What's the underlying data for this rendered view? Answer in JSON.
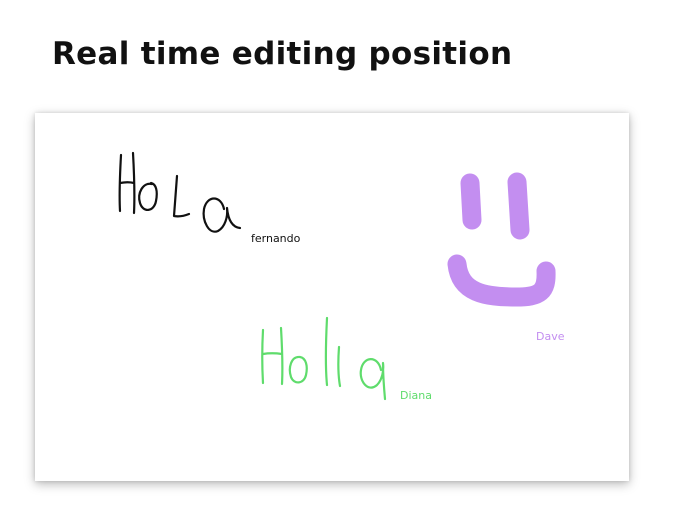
{
  "page": {
    "title": "Real time editing position"
  },
  "canvas": {
    "strokes": [
      {
        "author": "fernando",
        "text": "Hola",
        "color": "#111111",
        "shape": "handwritten-text"
      },
      {
        "author": "Dave",
        "color": "#c38ef0",
        "shape": "smiley-face"
      },
      {
        "author": "Diana",
        "text": "Hola",
        "color": "#5fdc6c",
        "shape": "handwritten-text"
      }
    ]
  }
}
